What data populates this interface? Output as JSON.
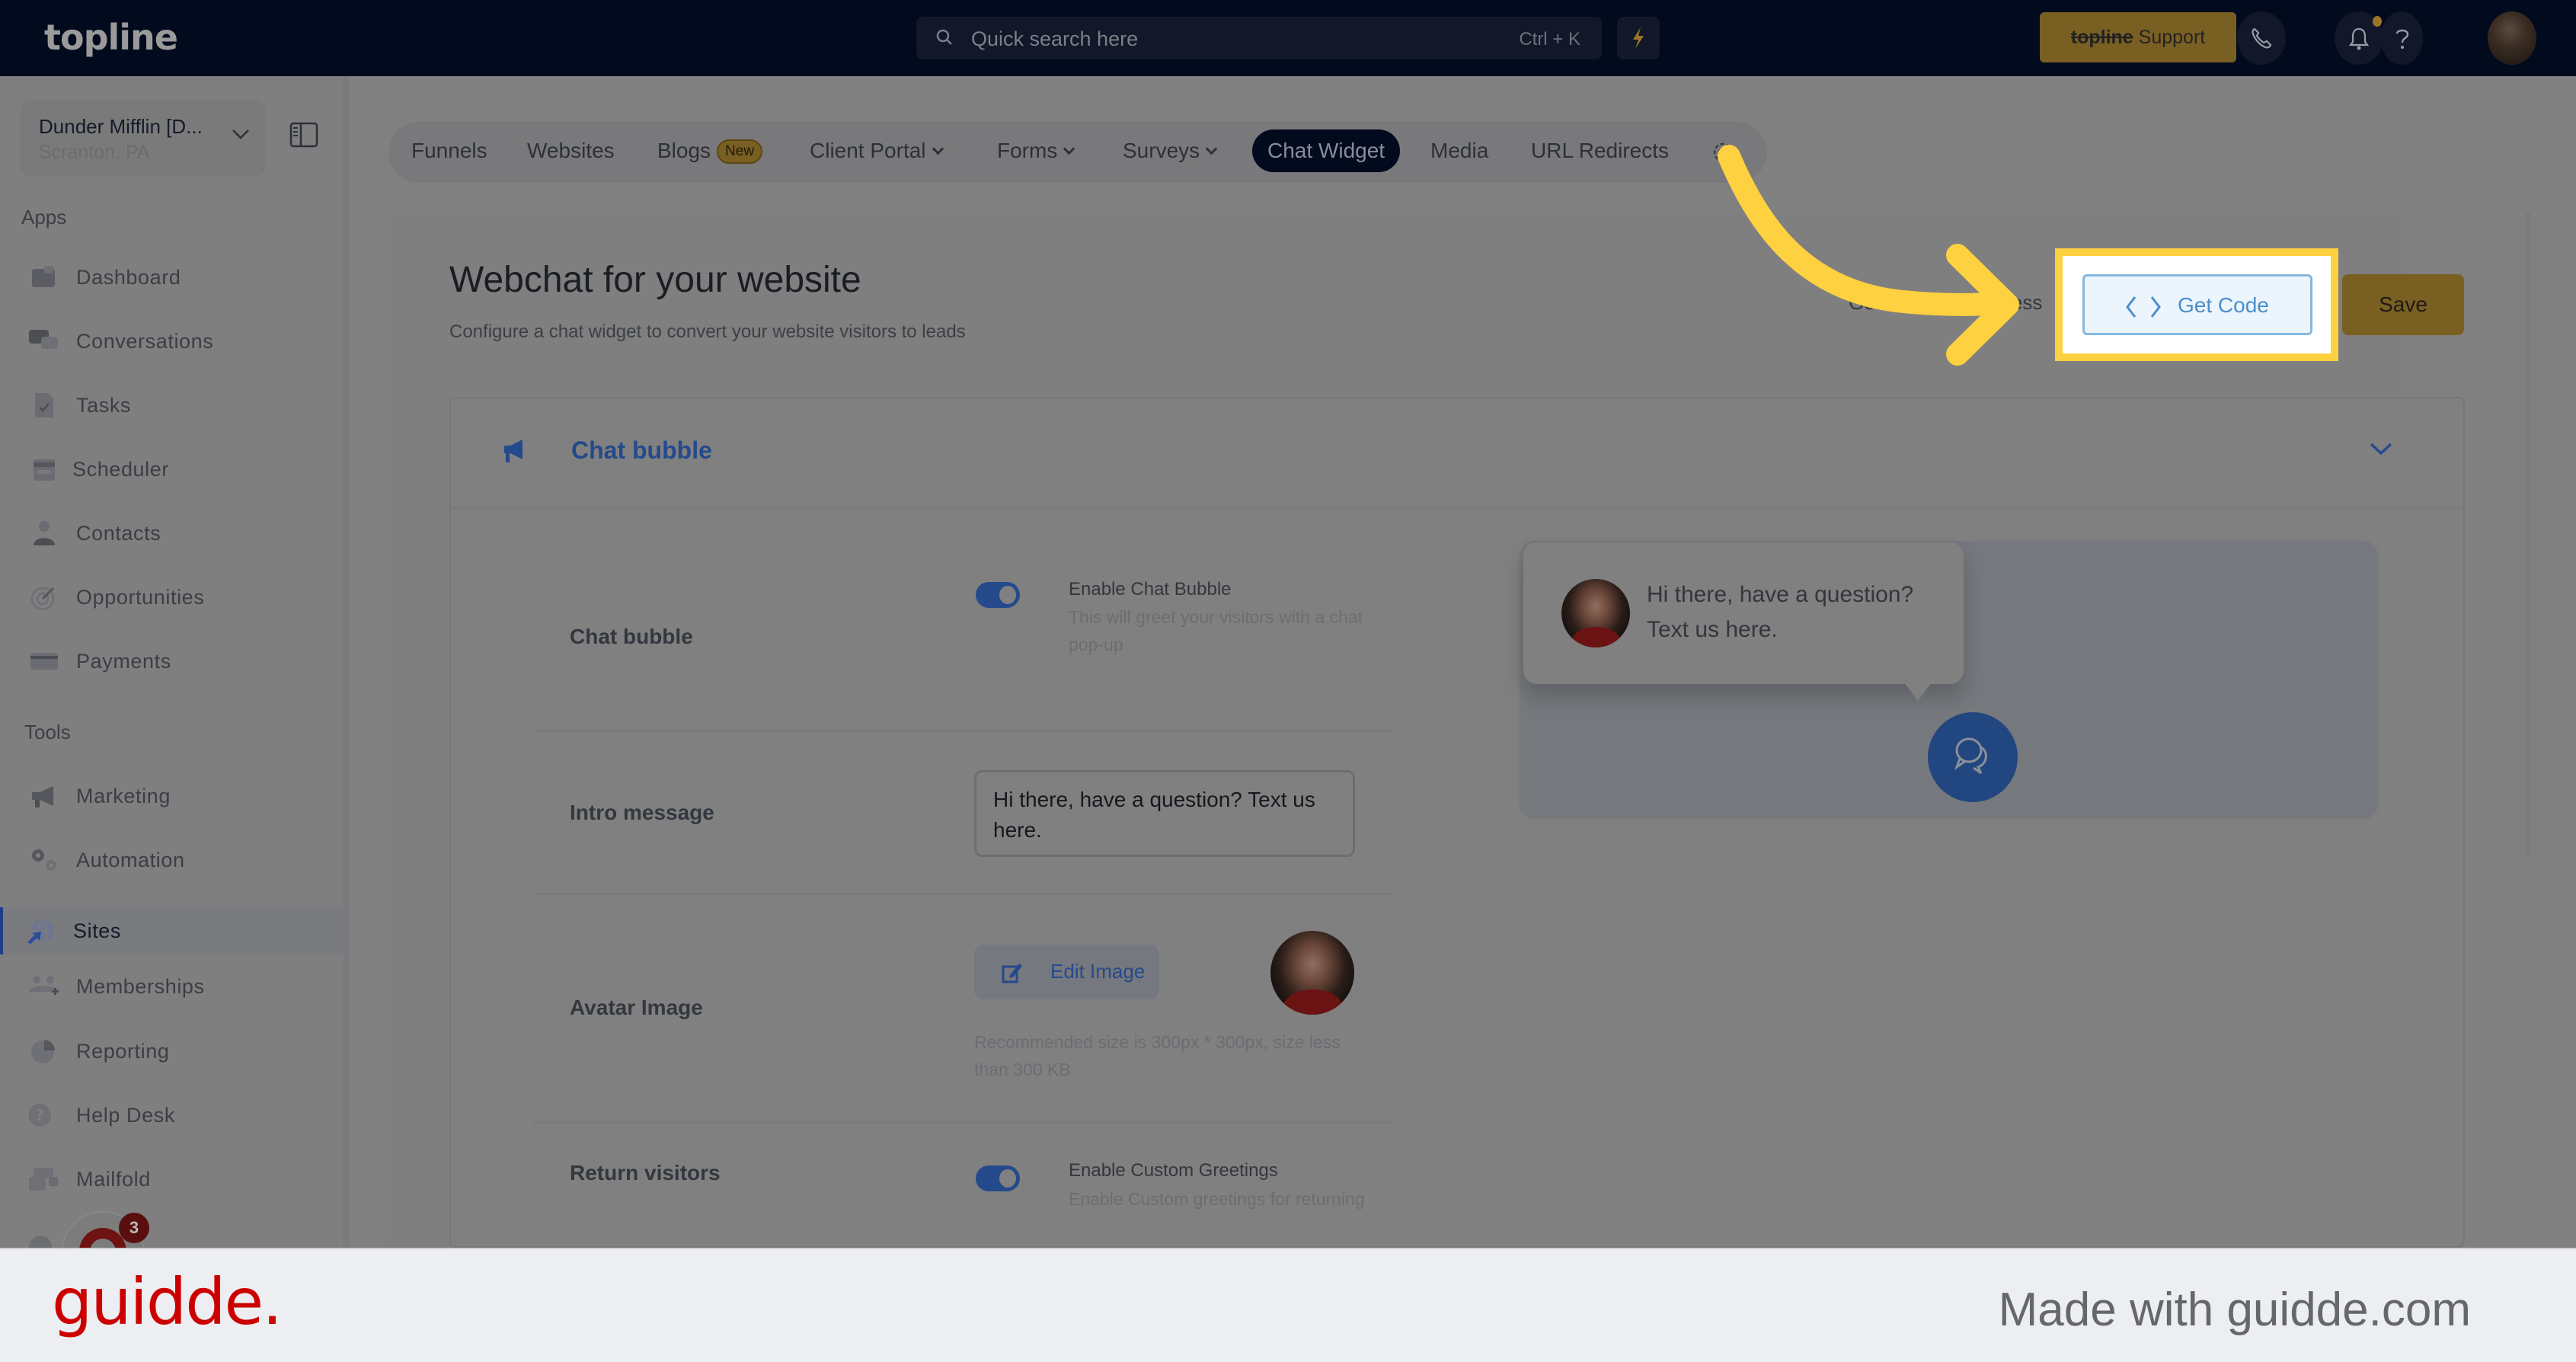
{
  "topbar": {
    "logo": "topline",
    "search_placeholder": "Quick search here",
    "search_shortcut": "Ctrl + K",
    "support_brand": "topline",
    "support_label": " Support",
    "icons": [
      "bolt-icon",
      "phone-icon",
      "bell-icon",
      "help-icon",
      "user-avatar"
    ]
  },
  "sidebar": {
    "account": {
      "name": "Dunder Mifflin [D...",
      "location": "Scranton, PA"
    },
    "apps_label": "Apps",
    "apps": [
      {
        "label": "Dashboard",
        "icon": "puzzle-icon"
      },
      {
        "label": "Conversations",
        "icon": "chat-bubbles-icon"
      },
      {
        "label": "Tasks",
        "icon": "task-file-icon"
      },
      {
        "label": "Scheduler",
        "icon": "calendar-icon"
      },
      {
        "label": "Contacts",
        "icon": "person-icon"
      },
      {
        "label": "Opportunities",
        "icon": "target-icon"
      },
      {
        "label": "Payments",
        "icon": "credit-card-icon"
      }
    ],
    "tools_label": "Tools",
    "tools": [
      {
        "label": "Marketing",
        "icon": "megaphone-icon"
      },
      {
        "label": "Automation",
        "icon": "gears-icon"
      },
      {
        "label": "Sites",
        "icon": "globe-cursor-icon",
        "active": true
      },
      {
        "label": "Memberships",
        "icon": "users-plus-icon"
      },
      {
        "label": "Reporting",
        "icon": "pie-chart-icon"
      },
      {
        "label": "Help Desk",
        "icon": "question-circle-icon"
      },
      {
        "label": "Mailfold",
        "icon": "mail-stack-icon"
      }
    ],
    "launcher_badge": "3"
  },
  "tabs": [
    {
      "label": "Funnels"
    },
    {
      "label": "Websites"
    },
    {
      "label": "Blogs",
      "badge": "New"
    },
    {
      "label": "Client Portal",
      "dropdown": true
    },
    {
      "label": "Forms",
      "dropdown": true
    },
    {
      "label": "Surveys",
      "dropdown": true
    },
    {
      "label": "Chat Widget",
      "active": true
    },
    {
      "label": "Media"
    },
    {
      "label": "URL Redirects"
    }
  ],
  "page": {
    "title": "Webchat for your website",
    "subtitle": "Configure a chat widget to convert your website visitors to leads",
    "obscured_button_left": "Get",
    "obscured_button_right": "ess",
    "get_code_label": "Get Code",
    "save_label": "Save"
  },
  "card": {
    "title": "Chat bubble",
    "rows": {
      "chat_bubble": {
        "label": "Chat bubble",
        "toggle_on": true,
        "option_title": "Enable Chat Bubble",
        "option_desc": "This will greet your visitors with a chat pop-up"
      },
      "intro": {
        "label": "Intro message",
        "value": "Hi there, have a question? Text us here."
      },
      "avatar": {
        "label": "Avatar Image",
        "edit_label": "Edit Image",
        "hint": "Recommended size is 300px * 300px, size less than 300 KB"
      },
      "return": {
        "label": "Return visitors",
        "toggle_on": true,
        "option_title": "Enable Custom Greetings",
        "option_desc": "Enable Custom greetings for returning"
      }
    },
    "preview": {
      "message": "Hi there, have a question? Text us here."
    }
  },
  "colors": {
    "topbar": "#020a1e",
    "accent_blue": "#254a8c",
    "brand_gold": "#7a5f22",
    "highlight_yellow": "#fed141",
    "get_code_blue": "#4a8fcc",
    "guidde_red": "#cc0000"
  },
  "footer": {
    "brand": "guidde.",
    "made_with": "Made with guidde.com"
  }
}
